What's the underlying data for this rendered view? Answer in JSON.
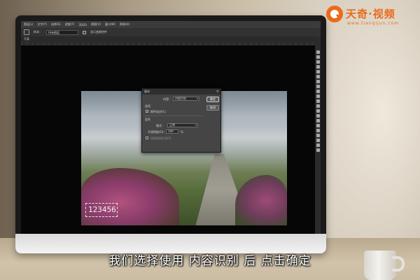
{
  "logo": {
    "name": "天奇·视频",
    "domain": "www.tianqijun.com"
  },
  "subtitle": "我们选择使用 内容识别 后 点击确定",
  "photoshop": {
    "menu": [
      "图层(L)",
      "文字(Y)",
      "选择(S)",
      "滤镜(T)",
      "3D(D)",
      "视图(V)",
      "窗口(W)",
      "帮助(H)"
    ],
    "options": {
      "sample_label": "样本：",
      "sample_value": "所有图层",
      "auto_label": "显示变换控件"
    },
    "doc_tab": "写真",
    "selection_text": "123456",
    "fill_dialog": {
      "title": "填充",
      "content_label": "内容：",
      "content_value": "内容识别",
      "options_label": "选项",
      "color_adapt_label": "颜色适应(C)",
      "color_adapt_checked": true,
      "blend_label": "混合",
      "mode_label": "模式：",
      "mode_value": "正常",
      "opacity_label": "不透明度(O)：",
      "opacity_value": "100",
      "opacity_unit": "%",
      "preserve_label": "保留透明区域(P)",
      "ok_label": "确定",
      "cancel_label": "取消"
    }
  }
}
